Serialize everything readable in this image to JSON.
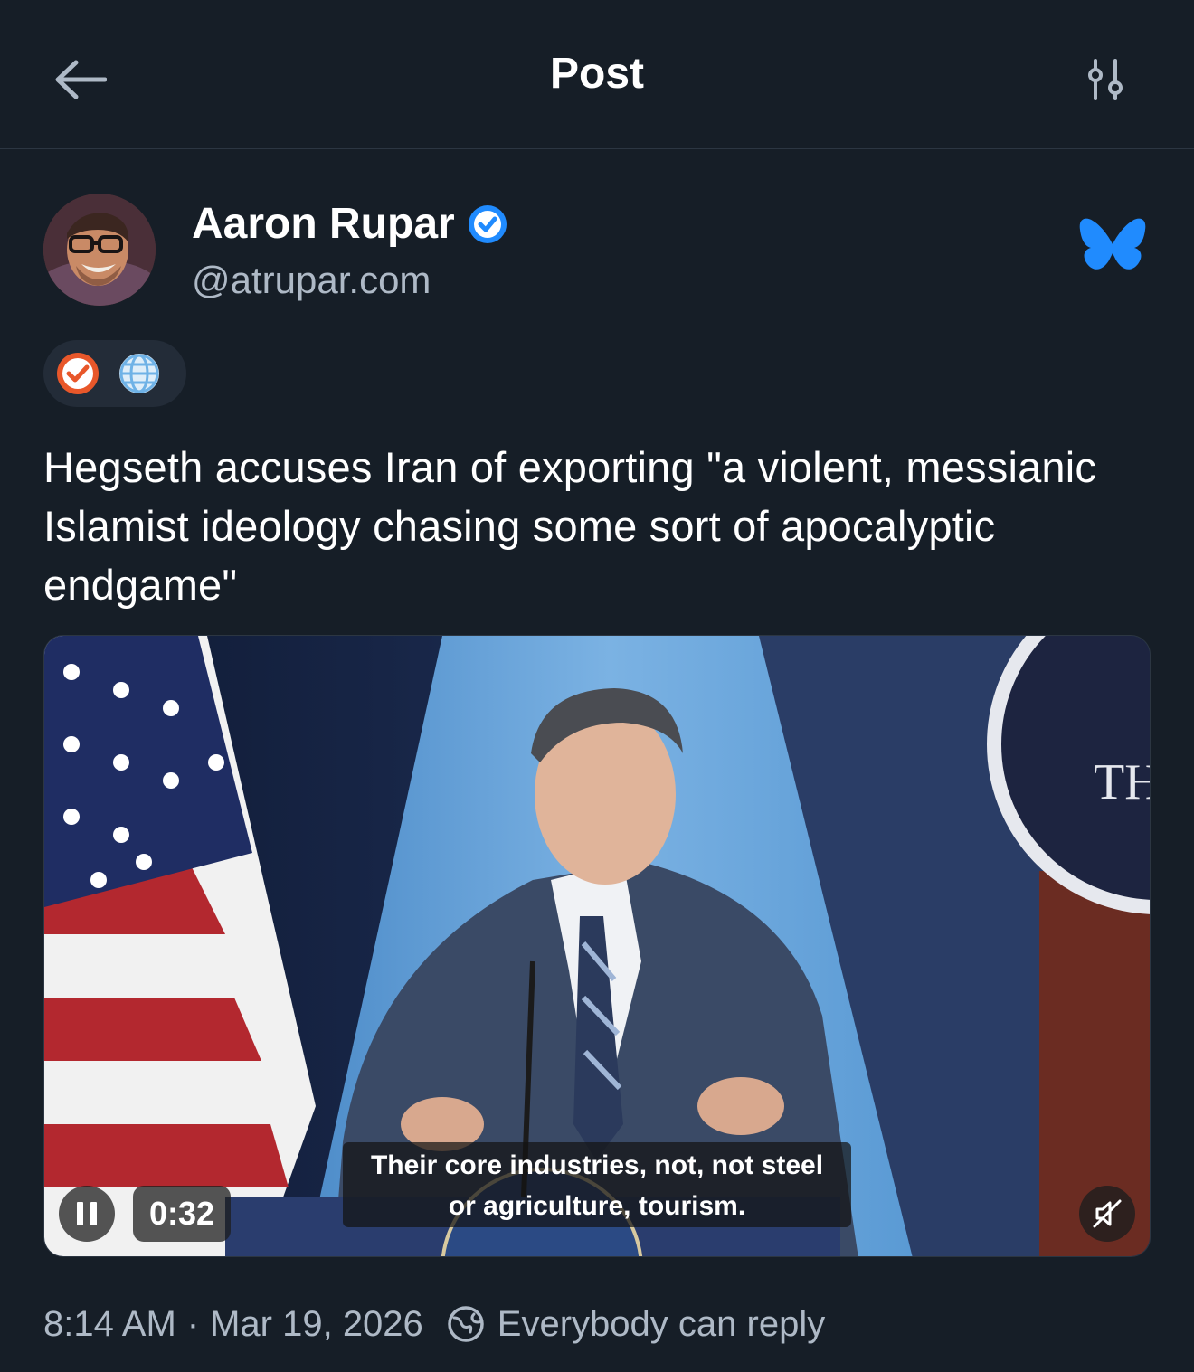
{
  "header": {
    "title": "Post",
    "back_icon": "arrow-left-icon",
    "filter_icon": "sliders-icon"
  },
  "author": {
    "display_name": "Aaron Rupar",
    "handle": "@atrupar.com",
    "verified": true,
    "verified_color": "#208bfe",
    "network_logo": "bluesky-butterfly-icon",
    "network_color": "#208bfe"
  },
  "labels": [
    {
      "icon": "checkmark-badge-icon",
      "color": "#e8572a"
    },
    {
      "icon": "globe-icon",
      "color": "#6fb2e6"
    }
  ],
  "post": {
    "text": "Hegseth accuses Iran of exporting \"a violent, messianic Islamist ideology chasing some sort of apocalyptic endgame\""
  },
  "video": {
    "elapsed": "0:32",
    "state": "playing",
    "muted": true,
    "caption_line1": "Their core industries, not, not steel",
    "caption_line2": "or agriculture, tourism.",
    "backdrop_text": "TH"
  },
  "footer": {
    "time": "8:14 AM",
    "separator": "·",
    "date": "Mar 19, 2026",
    "reply_setting": "Everybody can reply"
  },
  "colors": {
    "background": "#161e27",
    "secondary_text": "#aeb9c6",
    "accent": "#208bfe"
  }
}
